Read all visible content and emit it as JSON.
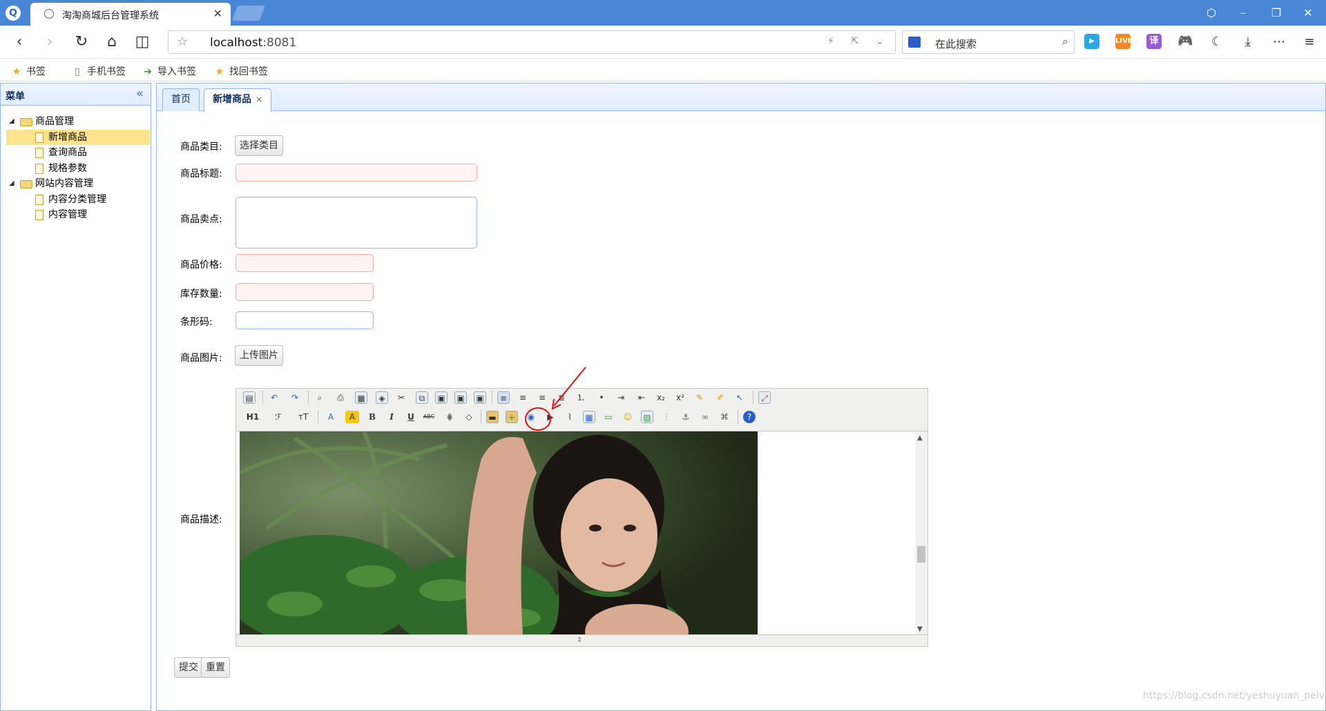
{
  "browser": {
    "tab_title": "淘淘商城后台管理系统",
    "tab_close": "✕",
    "url_host": "localhost",
    "url_port": ":8081",
    "search_placeholder": "在此搜索",
    "ext_live": "LIVE",
    "ext_translate": "译"
  },
  "bookmarks": [
    {
      "label": "书签",
      "icon": "star-icon"
    },
    {
      "label": "手机书签",
      "icon": "phone-icon"
    },
    {
      "label": "导入书签",
      "icon": "import-icon"
    },
    {
      "label": "找回书签",
      "icon": "star-icon"
    }
  ],
  "sidebar": {
    "title": "菜单",
    "collapse_icon": "«",
    "tree": [
      {
        "label": "商品管理",
        "type": "folder"
      },
      {
        "label": "新增商品",
        "type": "leaf",
        "selected": true
      },
      {
        "label": "查询商品",
        "type": "leaf"
      },
      {
        "label": "规格参数",
        "type": "leaf"
      },
      {
        "label": "网站内容管理",
        "type": "folder"
      },
      {
        "label": "内容分类管理",
        "type": "leaf"
      },
      {
        "label": "内容管理",
        "type": "leaf"
      }
    ]
  },
  "tabs": [
    {
      "label": "首页",
      "active": false
    },
    {
      "label": "新增商品",
      "active": true,
      "close": "×"
    }
  ],
  "form": {
    "category_label": "商品类目:",
    "category_button": "选择类目",
    "title_label": "商品标题:",
    "sellpoint_label": "商品卖点:",
    "price_label": "商品价格:",
    "stock_label": "库存数量:",
    "barcode_label": "条形码:",
    "image_label": "商品图片:",
    "image_button": "上传图片",
    "desc_label": "商品描述:",
    "submit_button": "提交",
    "reset_button": "重置"
  },
  "editor": {
    "toolbar_row2_text": {
      "h1": "H1",
      "font": "ℱ",
      "size": "тT",
      "color": "A",
      "bg": "A",
      "bold": "B",
      "italic": "I",
      "underline": "U",
      "strike": "ABC"
    }
  },
  "watermark": "https://blog.csdn.net/yeshuyuan_peiv"
}
